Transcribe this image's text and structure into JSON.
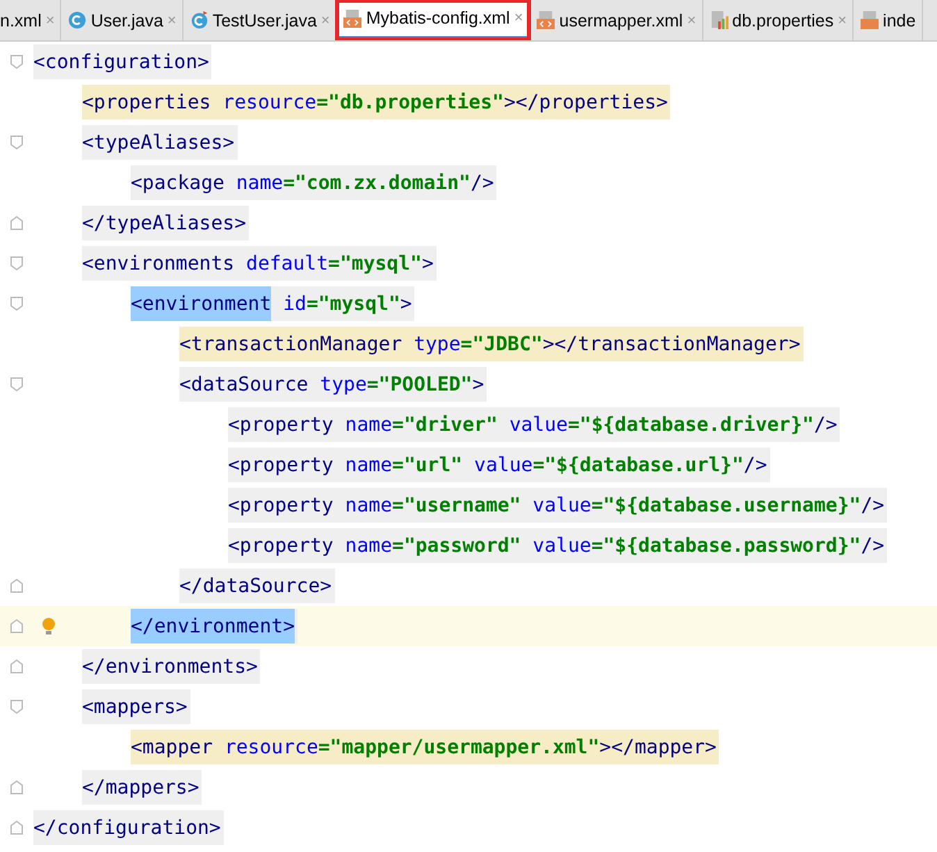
{
  "tabs": [
    {
      "label": "n.xml",
      "close": "×",
      "kind": "plain",
      "selected": false,
      "annotated": false
    },
    {
      "label": "User.java",
      "close": "×",
      "kind": "class",
      "selected": false,
      "annotated": false
    },
    {
      "label": "TestUser.java",
      "close": "×",
      "kind": "test-class",
      "selected": false,
      "annotated": false
    },
    {
      "label": "Mybatis-config.xml",
      "close": "×",
      "kind": "xml",
      "selected": true,
      "annotated": true
    },
    {
      "label": "usermapper.xml",
      "close": "×",
      "kind": "xml",
      "selected": false,
      "annotated": false
    },
    {
      "label": "db.properties",
      "close": "×",
      "kind": "properties",
      "selected": false,
      "annotated": false
    },
    {
      "label": "inde",
      "kind": "jsp",
      "selected": false,
      "annotated": false
    }
  ],
  "document": [
    {
      "start": {
        "tinted": false,
        "current": false,
        "tokens": [
          {
            "kind": "tag",
            "text": "<configuration>"
          }
        ]
      },
      "end": {
        "tinted": false,
        "current": false,
        "tokens": [
          {
            "kind": "tag",
            "text": "</configuration>"
          }
        ]
      },
      "children": [
        {
          "start": {
            "tinted": true,
            "current": false,
            "tokens": [
              {
                "kind": "tag",
                "text": "<properties "
              },
              {
                "kind": "attr",
                "text": "resource"
              },
              {
                "kind": "value",
                "text": "=\"db.properties\""
              },
              {
                "kind": "tag",
                "text": "></properties>"
              }
            ]
          }
        },
        {
          "start": {
            "tinted": false,
            "current": false,
            "tokens": [
              {
                "kind": "tag",
                "text": "<typeAliases>"
              }
            ]
          },
          "end": {
            "tinted": false,
            "current": false,
            "tokens": [
              {
                "kind": "tag",
                "text": "</typeAliases>"
              }
            ]
          },
          "children": [
            {
              "start": {
                "tinted": false,
                "current": false,
                "tokens": [
                  {
                    "kind": "tag",
                    "text": "<package "
                  },
                  {
                    "kind": "attr",
                    "text": "name"
                  },
                  {
                    "kind": "value",
                    "text": "=\"com.zx.domain\""
                  },
                  {
                    "kind": "tag",
                    "text": "/>"
                  }
                ]
              }
            }
          ]
        },
        {
          "start": {
            "tinted": false,
            "current": false,
            "tokens": [
              {
                "kind": "tag",
                "text": "<environments "
              },
              {
                "kind": "attr",
                "text": "default"
              },
              {
                "kind": "value",
                "text": "=\"mysql\""
              },
              {
                "kind": "tag",
                "text": ">"
              }
            ]
          },
          "end": {
            "tinted": false,
            "current": false,
            "tokens": [
              {
                "kind": "tag",
                "text": "</environments>"
              }
            ]
          },
          "children": [
            {
              "start": {
                "tinted": false,
                "current": false,
                "tokens": [
                  {
                    "kind": "match",
                    "text": "<environment"
                  },
                  {
                    "kind": "attr",
                    "text": " id"
                  },
                  {
                    "kind": "value",
                    "text": "=\"mysql\""
                  },
                  {
                    "kind": "tag",
                    "text": ">"
                  }
                ]
              },
              "end": {
                "tinted": false,
                "current": true,
                "tokens": [
                  {
                    "kind": "match",
                    "text": "</environment>"
                  }
                ]
              },
              "children": [
                {
                  "start": {
                    "tinted": true,
                    "current": false,
                    "tokens": [
                      {
                        "kind": "tag",
                        "text": "<transactionManager "
                      },
                      {
                        "kind": "attr",
                        "text": "type"
                      },
                      {
                        "kind": "value",
                        "text": "=\"JDBC\""
                      },
                      {
                        "kind": "tag",
                        "text": "></transactionManager>"
                      }
                    ]
                  }
                },
                {
                  "start": {
                    "tinted": false,
                    "current": false,
                    "tokens": [
                      {
                        "kind": "tag",
                        "text": "<dataSource "
                      },
                      {
                        "kind": "attr",
                        "text": "type"
                      },
                      {
                        "kind": "value",
                        "text": "=\"POOLED\""
                      },
                      {
                        "kind": "tag",
                        "text": ">"
                      }
                    ]
                  },
                  "end": {
                    "tinted": false,
                    "current": false,
                    "tokens": [
                      {
                        "kind": "tag",
                        "text": "</dataSource>"
                      }
                    ]
                  },
                  "children": [
                    {
                      "start": {
                        "tinted": false,
                        "current": false,
                        "tokens": [
                          {
                            "kind": "tag",
                            "text": "<property "
                          },
                          {
                            "kind": "attr",
                            "text": "name"
                          },
                          {
                            "kind": "value",
                            "text": "=\"driver\" "
                          },
                          {
                            "kind": "attr",
                            "text": "value"
                          },
                          {
                            "kind": "value",
                            "text": "=\"${database.driver}\""
                          },
                          {
                            "kind": "tag",
                            "text": "/>"
                          }
                        ]
                      }
                    },
                    {
                      "start": {
                        "tinted": false,
                        "current": false,
                        "tokens": [
                          {
                            "kind": "tag",
                            "text": "<property "
                          },
                          {
                            "kind": "attr",
                            "text": "name"
                          },
                          {
                            "kind": "value",
                            "text": "=\"url\" "
                          },
                          {
                            "kind": "attr",
                            "text": "value"
                          },
                          {
                            "kind": "value",
                            "text": "=\"${database.url}\""
                          },
                          {
                            "kind": "tag",
                            "text": "/>"
                          }
                        ]
                      }
                    },
                    {
                      "start": {
                        "tinted": false,
                        "current": false,
                        "tokens": [
                          {
                            "kind": "tag",
                            "text": "<property "
                          },
                          {
                            "kind": "attr",
                            "text": "name"
                          },
                          {
                            "kind": "value",
                            "text": "=\"username\" "
                          },
                          {
                            "kind": "attr",
                            "text": "value"
                          },
                          {
                            "kind": "value",
                            "text": "=\"${database.username}\""
                          },
                          {
                            "kind": "tag",
                            "text": "/>"
                          }
                        ]
                      }
                    },
                    {
                      "start": {
                        "tinted": false,
                        "current": false,
                        "tokens": [
                          {
                            "kind": "tag",
                            "text": "<property "
                          },
                          {
                            "kind": "attr",
                            "text": "name"
                          },
                          {
                            "kind": "value",
                            "text": "=\"password\" "
                          },
                          {
                            "kind": "attr",
                            "text": "value"
                          },
                          {
                            "kind": "value",
                            "text": "=\"${database.password}\""
                          },
                          {
                            "kind": "tag",
                            "text": "/>"
                          }
                        ]
                      }
                    }
                  ]
                }
              ]
            }
          ]
        },
        {
          "start": {
            "tinted": false,
            "current": false,
            "tokens": [
              {
                "kind": "tag",
                "text": "<mappers>"
              }
            ]
          },
          "end": {
            "tinted": false,
            "current": false,
            "tokens": [
              {
                "kind": "tag",
                "text": "</mappers>"
              }
            ]
          },
          "children": [
            {
              "start": {
                "tinted": true,
                "current": false,
                "tokens": [
                  {
                    "kind": "tag",
                    "text": "<mapper "
                  },
                  {
                    "kind": "attr",
                    "text": "resource"
                  },
                  {
                    "kind": "value",
                    "text": "=\"mapper/usermapper.xml\""
                  },
                  {
                    "kind": "tag",
                    "text": "></mapper>"
                  }
                ]
              }
            }
          ]
        }
      ]
    }
  ]
}
